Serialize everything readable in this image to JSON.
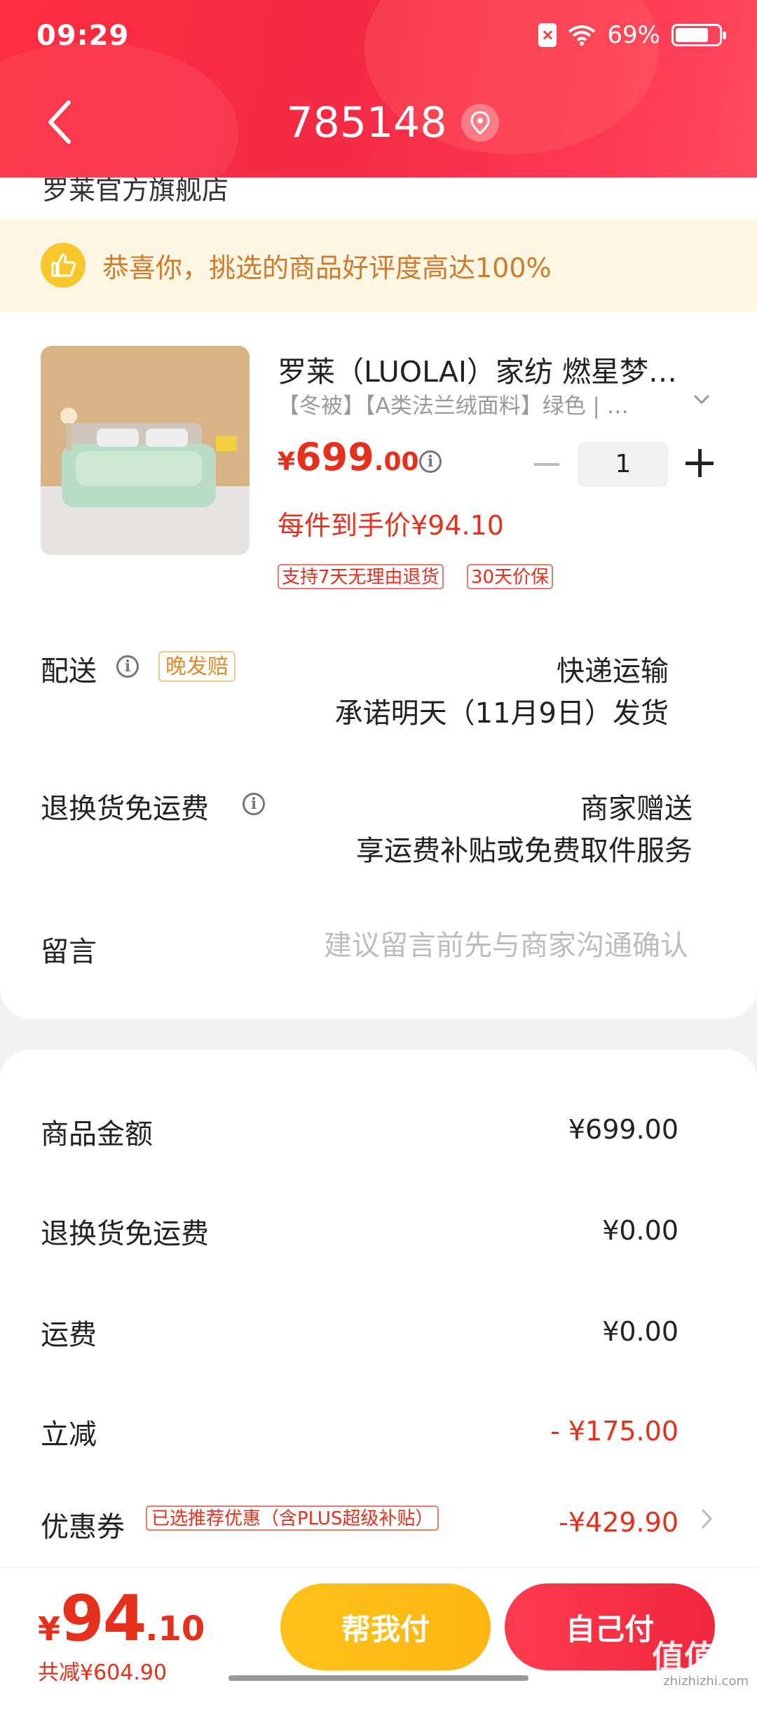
{
  "status_bar": {
    "time": "09:29",
    "battery": "69%"
  },
  "header": {
    "title": "785148"
  },
  "store": {
    "name_partial": "罗莱官方旗舰店"
  },
  "banner": {
    "text": "恭喜你，挑选的商品好评度高达100%"
  },
  "product": {
    "title": "罗莱（LUOLAI）家纺 燃星梦…",
    "spec": "【冬被】【A类法兰绒面料】绿色 | …",
    "price_yen": "¥",
    "price_int": "699",
    "price_dec": ".00",
    "quantity": "1",
    "hand_price": "每件到手价¥94.10",
    "tags": [
      "支持7天无理由退货",
      "30天价保"
    ]
  },
  "delivery": {
    "label": "配送",
    "badge": "晚发赔",
    "method": "快递运输",
    "promise": "承诺明天（11月9日）发货"
  },
  "return_freight": {
    "label": "退换货免运费",
    "value": "商家赠送",
    "desc": "享运费补贴或免费取件服务"
  },
  "message": {
    "label": "留言",
    "placeholder": "建议留言前先与商家沟通确认"
  },
  "summary": {
    "goods_label": "商品金额",
    "goods_value": "¥699.00",
    "return_label": "退换货免运费",
    "return_value": "¥0.00",
    "freight_label": "运费",
    "freight_value": "¥0.00",
    "discount_label": "立减",
    "discount_value": "- ¥175.00",
    "coupon_label": "优惠券",
    "coupon_tag": "已选推荐优惠（含PLUS超级补贴）",
    "coupon_value": "-¥429.90"
  },
  "bottom": {
    "total_yen": "¥",
    "total_int": "94",
    "total_dec": ".10",
    "saved": "共减¥604.90",
    "help_pay": "帮我付",
    "self_pay": "自己付"
  },
  "watermark": {
    "text": "值值值",
    "sub": "zhizhizhi.com"
  },
  "colors": {
    "accent_red": "#e4301d",
    "header_red": "#f42a44",
    "yellow": "#ffc21a"
  }
}
